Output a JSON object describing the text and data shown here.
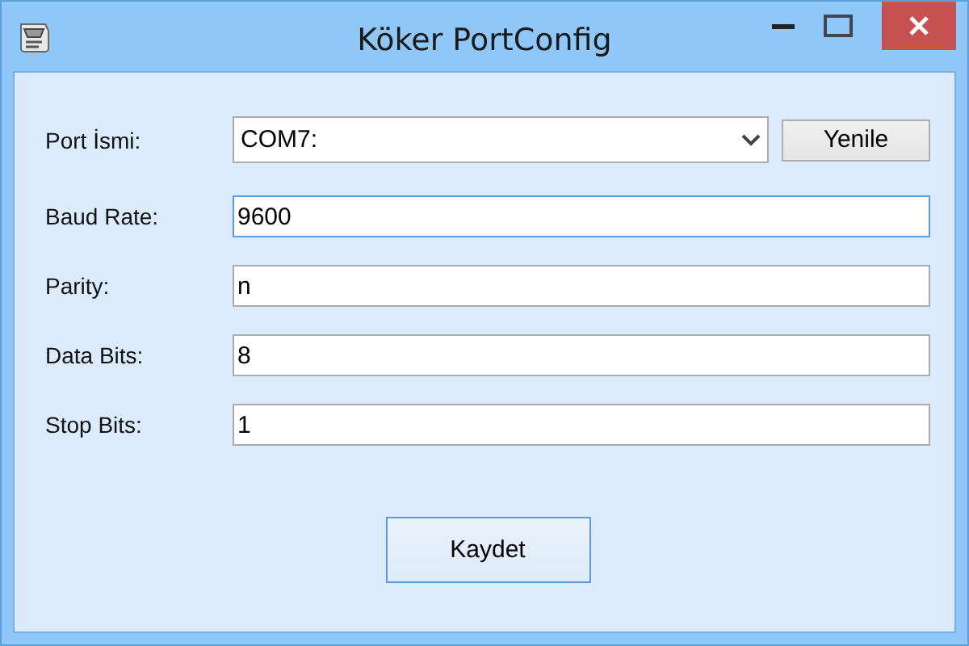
{
  "window": {
    "title": "Köker PortConfig"
  },
  "fields": [
    {
      "label": "Port İsmi:",
      "kind": "dropdown",
      "value": "COM7:",
      "focused": false,
      "button": "Yenile"
    },
    {
      "label": "Baud Rate:",
      "kind": "text",
      "value": "9600",
      "focused": true
    },
    {
      "label": "Parity:",
      "kind": "text",
      "value": "n",
      "focused": false
    },
    {
      "label": "Data Bits:",
      "kind": "text",
      "value": "8",
      "focused": false
    },
    {
      "label": "Stop Bits:",
      "kind": "text",
      "value": "1",
      "focused": false
    }
  ],
  "save_button": "Kaydet"
}
